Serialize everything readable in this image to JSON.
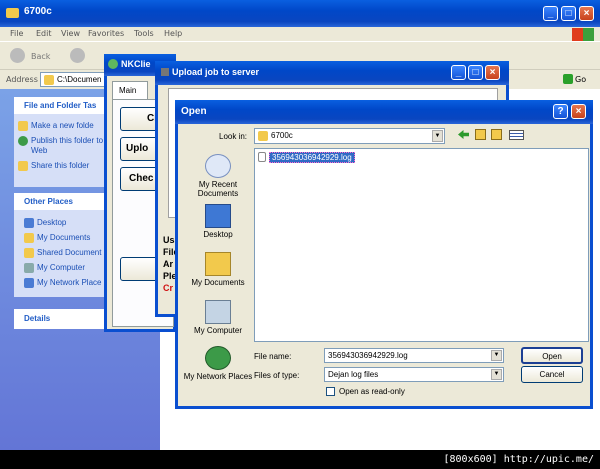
{
  "explorer": {
    "title": "6700c",
    "menu": [
      "File",
      "Edit",
      "View",
      "Favorites",
      "Tools",
      "Help"
    ],
    "back_label": "Back",
    "address_label": "Address",
    "address_value": "C:\\Documen",
    "go_label": "Go",
    "file_tasks_header": "File and Folder Tas",
    "file_tasks": [
      "Make a new folde",
      "Publish this folder to the",
      "Web",
      "Share this folder"
    ],
    "other_places_header": "Other Places",
    "other_places": [
      "Desktop",
      "My Documents",
      "Shared Document",
      "My Computer",
      "My Network Place"
    ],
    "details_header": "Details"
  },
  "nkclient": {
    "title": "NKClie",
    "tab": "Main",
    "buttons": [
      "Cl",
      "Uplo",
      "Chec"
    ],
    "lines": [
      "Us",
      "File",
      "Ar",
      "Ple",
      "Cr"
    ]
  },
  "upload": {
    "title": "Upload job to server"
  },
  "open": {
    "title": "Open",
    "help": "?",
    "close": "×",
    "look_in_label": "Look in:",
    "look_in_value": "6700c",
    "places": [
      "My Recent Documents",
      "Desktop",
      "My Documents",
      "My Computer",
      "My Network Places"
    ],
    "files": [
      "356943036942929.log"
    ],
    "file_name_label": "File name:",
    "file_name_value": "356943036942929.log",
    "file_type_label": "Files of type:",
    "file_type_value": "Dejan log files",
    "readonly_label": "Open as read-only",
    "open_btn": "Open",
    "cancel_btn": "Cancel"
  },
  "watermark": "[800x600] http://upic.me/"
}
